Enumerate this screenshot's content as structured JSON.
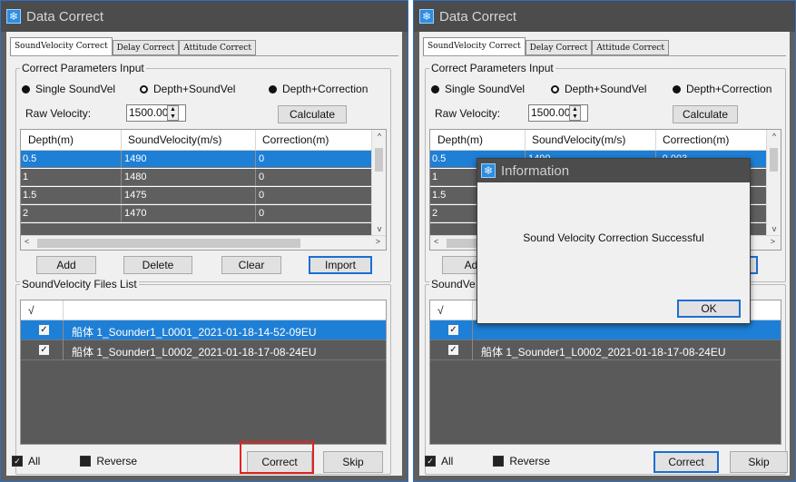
{
  "left_window": {
    "title": "Data Correct",
    "tabs": [
      "SoundVelocity Correct",
      "Delay Correct",
      "Attitude Correct"
    ],
    "params_group_title": "Correct Parameters Input",
    "radios": [
      "Single SoundVel",
      "Depth+SoundVel",
      "Depth+Correction"
    ],
    "raw_velocity_label": "Raw Velocity:",
    "raw_velocity_value": "1500.000",
    "calculate_label": "Calculate",
    "columns": [
      "Depth(m)",
      "SoundVelocity(m/s)",
      "Correction(m)"
    ],
    "rows": [
      [
        "0.5",
        "1490",
        "0"
      ],
      [
        "1",
        "1480",
        "0"
      ],
      [
        "1.5",
        "1475",
        "0"
      ],
      [
        "2",
        "1470",
        "0"
      ]
    ],
    "buttons": {
      "add": "Add",
      "delete": "Delete",
      "clear": "Clear",
      "import": "Import"
    },
    "files_group_title": "SoundVelocity Files List",
    "files_header": "√",
    "files": [
      "船体 1_Sounder1_L0001_2021-01-18-14-52-09EU",
      "船体 1_Sounder1_L0002_2021-01-18-17-08-24EU"
    ],
    "all_label": "All",
    "reverse_label": "Reverse",
    "correct_label": "Correct",
    "skip_label": "Skip"
  },
  "right_window": {
    "title": "Data Correct",
    "tabs": [
      "SoundVelocity Correct",
      "Delay Correct",
      "Attitude Correct"
    ],
    "params_group_title": "Correct Parameters Input",
    "radios": [
      "Single SoundVel",
      "Depth+SoundVel",
      "Depth+Correction"
    ],
    "raw_velocity_label": "Raw Velocity:",
    "raw_velocity_value": "1500.000",
    "calculate_label": "Calculate",
    "columns": [
      "Depth(m)",
      "SoundVelocity(m/s)",
      "Correction(m)"
    ],
    "row_first": [
      "0.5",
      "1490",
      "-0.003"
    ],
    "row_labels": [
      "1",
      "1.5",
      "2"
    ],
    "add_partial": "Ad",
    "import_partial": "rt",
    "files_group_partial": "SoundVe",
    "files_header": "√",
    "file2": "船体 1_Sounder1_L0002_2021-01-18-17-08-24EU",
    "all_label": "All",
    "reverse_label": "Reverse",
    "correct_label": "Correct",
    "skip_label": "Skip"
  },
  "dialog": {
    "title": "Information",
    "message": "Sound Velocity Correction Successful",
    "ok_label": "OK"
  },
  "colors": {
    "selection": "#1e7fd6",
    "highlight": "#e0241d",
    "titlebar": "#4c4c4c"
  }
}
